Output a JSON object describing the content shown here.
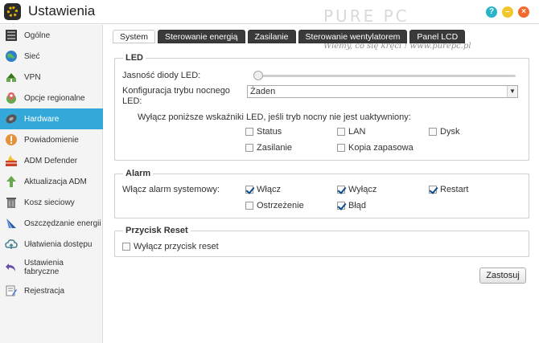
{
  "window": {
    "title": "Ustawienia",
    "watermark": "PURE PC",
    "watermark_tagline": "Wiemy, co się kręci ! www.purepc.pl"
  },
  "sidebar": {
    "items": [
      {
        "label": "Ogólne",
        "icon": "server-icon"
      },
      {
        "label": "Sieć",
        "icon": "globe-icon"
      },
      {
        "label": "VPN",
        "icon": "vpn-icon"
      },
      {
        "label": "Opcje regionalne",
        "icon": "location-pin-icon"
      },
      {
        "label": "Hardware",
        "icon": "hardware-disk-icon",
        "active": true
      },
      {
        "label": "Powiadomienie",
        "icon": "exclamation-icon"
      },
      {
        "label": "ADM Defender",
        "icon": "firewall-icon"
      },
      {
        "label": "Aktualizacja ADM",
        "icon": "upload-arrow-icon"
      },
      {
        "label": "Kosz sieciowy",
        "icon": "trash-icon"
      },
      {
        "label": "Oszczędzanie energii",
        "icon": "energy-icon"
      },
      {
        "label": "Ułatwienia dostępu",
        "icon": "cloud-access-icon"
      },
      {
        "label": "Ustawienia fabryczne",
        "icon": "undo-icon"
      },
      {
        "label": "Rejestracja",
        "icon": "registration-icon"
      }
    ]
  },
  "tabs": [
    "System",
    "Sterowanie energią",
    "Zasilanie",
    "Sterowanie wentylatorem",
    "Panel LCD"
  ],
  "led": {
    "legend": "LED",
    "brightness_label": "Jasność diody LED:",
    "brightness_value": 0,
    "night_mode_label": "Konfiguracja trybu nocnego LED:",
    "night_mode_value": "Żaden",
    "note": "Wyłącz poniższe wskaźniki LED, jeśli tryb nocny nie jest uaktywniony:",
    "options": [
      {
        "label": "Status",
        "checked": false
      },
      {
        "label": "LAN",
        "checked": false
      },
      {
        "label": "Dysk",
        "checked": false
      },
      {
        "label": "Zasilanie",
        "checked": false
      },
      {
        "label": "Kopia zapasowa",
        "checked": false
      }
    ]
  },
  "alarm": {
    "legend": "Alarm",
    "label": "Włącz alarm systemowy:",
    "options": [
      {
        "label": "Włącz",
        "checked": true
      },
      {
        "label": "Wyłącz",
        "checked": true
      },
      {
        "label": "Restart",
        "checked": true
      },
      {
        "label": "Ostrzeżenie",
        "checked": false
      },
      {
        "label": "Błąd",
        "checked": true
      }
    ]
  },
  "reset": {
    "legend": "Przycisk Reset",
    "option": {
      "label": "Wyłącz przycisk reset",
      "checked": false
    }
  },
  "apply_label": "Zastosuj"
}
